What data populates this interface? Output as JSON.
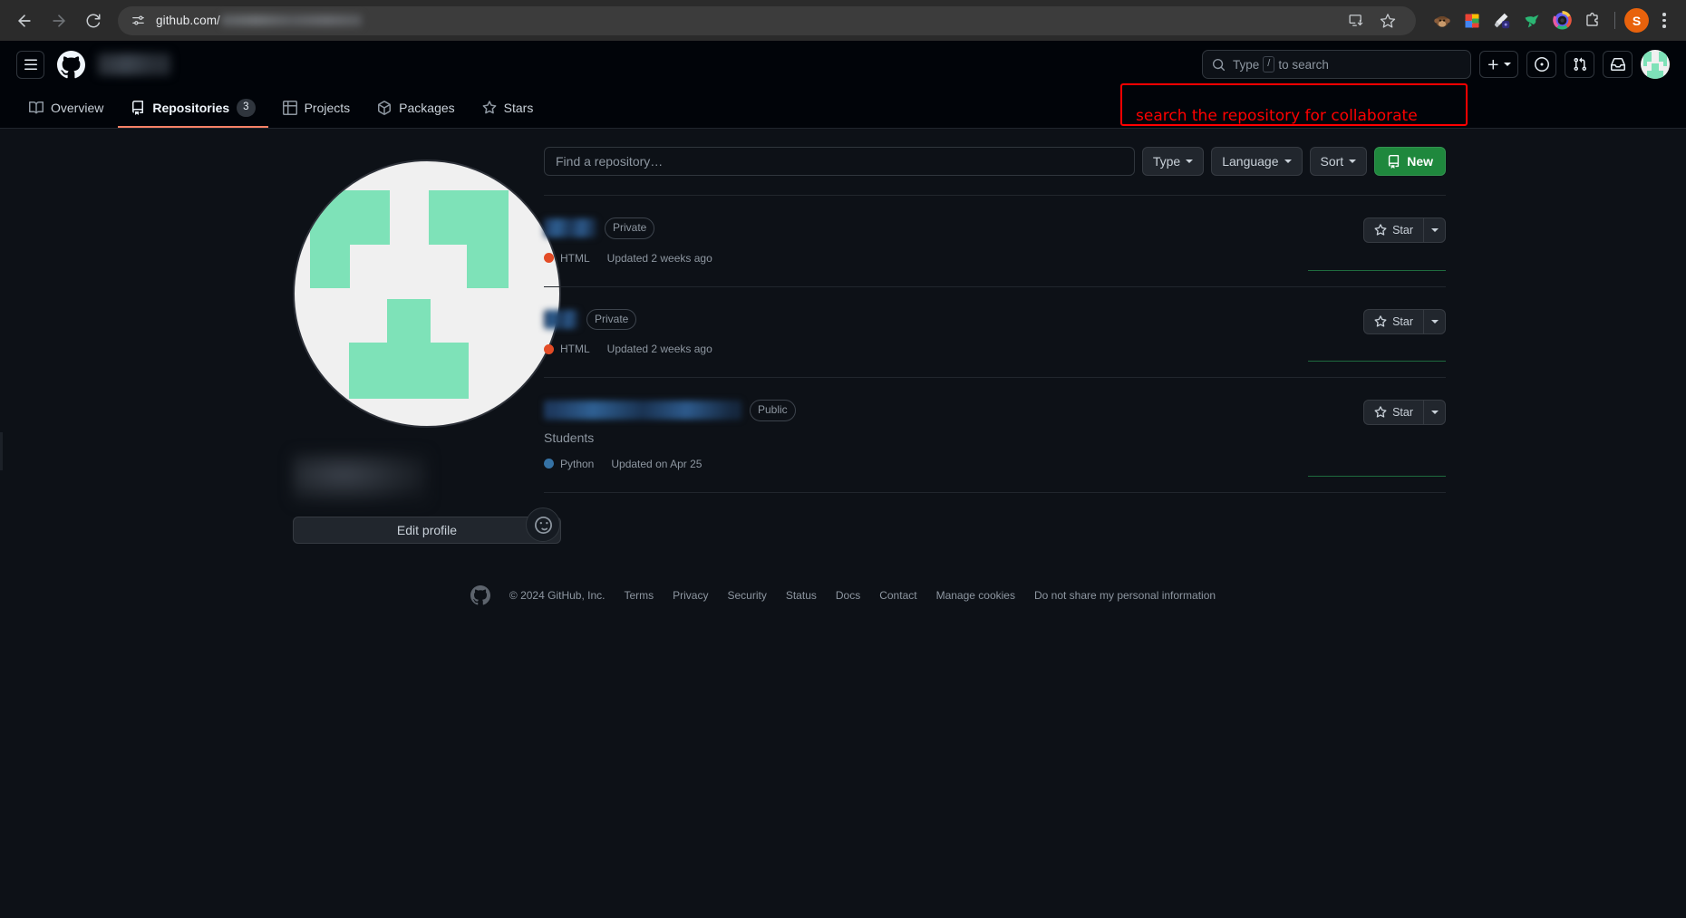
{
  "browser": {
    "back_icon": "back-arrow-icon",
    "forward_icon": "forward-arrow-icon",
    "reload_icon": "reload-icon",
    "site_settings_icon": "site-settings-icon",
    "url": "github.com/",
    "url_redacted": true,
    "install_icon": "install-app-icon",
    "bookmark_icon": "bookmark-star-icon",
    "extensions": [
      {
        "name": "monkey-extension-icon",
        "color": "#8b5e3c"
      },
      {
        "name": "google-sheets-extension-icon",
        "color": "#0f9d58"
      },
      {
        "name": "grammarly-extension-icon",
        "color": "#2f2a7a"
      },
      {
        "name": "jumpcut-extension-icon",
        "color": "#2bb673"
      },
      {
        "name": "loom-extension-icon",
        "color": "#625df5"
      },
      {
        "name": "puzzle-extensions-icon",
        "color": "#d0d3d6"
      }
    ],
    "profile_initial": "S",
    "menu_icon": "kebab-menu-icon"
  },
  "header": {
    "hamburger_icon": "hamburger-menu-icon",
    "logo_icon": "github-mark-icon",
    "owner_redacted": true,
    "search": {
      "icon": "search-icon",
      "placeholder_prefix": "Type",
      "key_hint": "/",
      "placeholder_suffix": "to search",
      "highlighted": true,
      "highlight_color": "#ff0000"
    },
    "create_new_icon": "plus-icon",
    "create_new_caret_icon": "chevron-down-icon",
    "issues_icon": "issue-opened-icon",
    "pull_requests_icon": "git-pull-request-icon",
    "inbox_icon": "inbox-icon",
    "avatar_icon": "user-avatar"
  },
  "annotation": {
    "text": "search the repository for collaborate",
    "color": "#ff0000"
  },
  "nav_tabs": [
    {
      "label": "Overview",
      "icon": "book-icon",
      "active": false,
      "count": null
    },
    {
      "label": "Repositories",
      "icon": "repo-icon",
      "active": true,
      "count": "3"
    },
    {
      "label": "Projects",
      "icon": "table-icon",
      "active": false,
      "count": null
    },
    {
      "label": "Packages",
      "icon": "package-icon",
      "active": false,
      "count": null
    },
    {
      "label": "Stars",
      "icon": "star-icon",
      "active": false,
      "count": null
    }
  ],
  "profile": {
    "avatar_redacted": false,
    "name_redacted": true,
    "status_emoji_icon": "smiley-icon",
    "edit_profile_label": "Edit profile"
  },
  "filters": {
    "find_placeholder": "Find a repository…",
    "find_value": "",
    "type_label": "Type",
    "language_label": "Language",
    "sort_label": "Sort",
    "new_label": "New",
    "new_icon": "repo-icon",
    "caret_icon": "chevron-down-icon"
  },
  "repositories": [
    {
      "name_redacted": true,
      "name_width": 58,
      "visibility": "Private",
      "description": null,
      "language": "HTML",
      "language_color": "#e34c26",
      "updated": "Updated 2 weeks ago",
      "star_label": "Star",
      "star_icon": "star-icon",
      "star_caret_icon": "chevron-down-icon"
    },
    {
      "name_redacted": true,
      "name_width": 38,
      "visibility": "Private",
      "description": null,
      "language": "HTML",
      "language_color": "#e34c26",
      "updated": "Updated 2 weeks ago",
      "star_label": "Star",
      "star_icon": "star-icon",
      "star_caret_icon": "chevron-down-icon"
    },
    {
      "name_redacted": true,
      "name_width": 218,
      "visibility": "Public",
      "description": "Students",
      "language": "Python",
      "language_color": "#3572a5",
      "updated": "Updated on Apr 25",
      "star_label": "Star",
      "star_icon": "star-icon",
      "star_caret_icon": "chevron-down-icon"
    }
  ],
  "footer": {
    "logo_icon": "github-mark-icon",
    "copyright": "© 2024 GitHub, Inc.",
    "links": [
      "Terms",
      "Privacy",
      "Security",
      "Status",
      "Docs",
      "Contact",
      "Manage cookies",
      "Do not share my personal information"
    ]
  }
}
